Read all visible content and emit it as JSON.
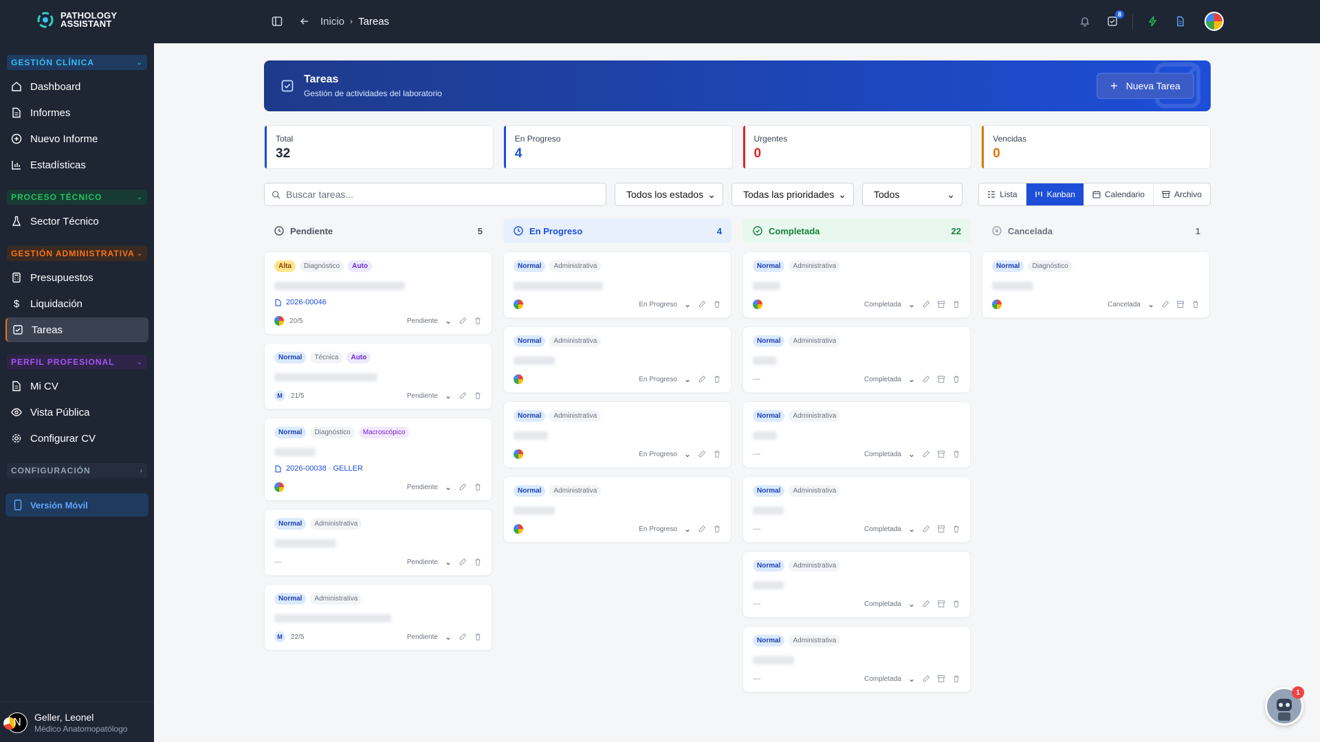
{
  "app": {
    "logo_line1": "PATHOLOGY",
    "logo_line2": "ASSISTANT"
  },
  "header": {
    "crumb_home": "Inicio",
    "crumb_current": "Tareas",
    "tasks_badge": "8"
  },
  "sidebar": {
    "sections": [
      {
        "label": "GESTIÓN CLÍNICA",
        "color": "#38bdf8",
        "items": [
          "Dashboard",
          "Informes",
          "Nuevo Informe",
          "Estadísticas"
        ]
      },
      {
        "label": "PROCESO TÉCNICO",
        "color": "#22c55e",
        "items": [
          "Sector Técnico"
        ]
      },
      {
        "label": "GESTIÓN ADMINISTRATIVA",
        "color": "#f97316",
        "items": [
          "Presupuestos",
          "Liquidación",
          "Tareas"
        ]
      },
      {
        "label": "PERFIL PROFESIONAL",
        "color": "#a855f7",
        "items": [
          "Mi CV",
          "Vista Pública",
          "Configurar CV"
        ]
      },
      {
        "label": "CONFIGURACIÓN",
        "color": "#94a3b8",
        "items": []
      }
    ],
    "mobile": "Versión Móvil",
    "user": {
      "initial": "N",
      "name": "Geller, Leonel",
      "role": "Médico Anatomopatólogo"
    }
  },
  "banner": {
    "title": "Tareas",
    "subtitle": "Gestión de actividades del laboratorio",
    "new_button": "Nueva Tarea"
  },
  "stats": [
    {
      "label": "Total",
      "value": "32",
      "color": "#1f2937"
    },
    {
      "label": "En Progreso",
      "value": "4",
      "color": "#1d4ed8"
    },
    {
      "label": "Urgentes",
      "value": "0",
      "color": "#dc2626"
    },
    {
      "label": "Vencidas",
      "value": "0",
      "color": "#d97706"
    }
  ],
  "filters": {
    "search_placeholder": "Buscar tareas...",
    "status": "Todos los estados",
    "priority": "Todas las prioridades",
    "assignee": "Todos",
    "views": [
      "Lista",
      "Kanban",
      "Calendario",
      "Archivo"
    ]
  },
  "columns": [
    {
      "title": "Pendiente",
      "count": "5",
      "color": "#4b5563",
      "bg": "#f5f6f8",
      "cards": [
        {
          "tags": [
            [
              "Alta",
              "alta"
            ],
            [
              "Diagnóstico",
              "cat"
            ],
            [
              "Auto",
              "auto"
            ]
          ],
          "case": "2026-00046",
          "avatar": "g",
          "date": "20/5",
          "status": "Pendiente"
        },
        {
          "tags": [
            [
              "Normal",
              "normal"
            ],
            [
              "Técnica",
              "cat"
            ],
            [
              "Auto",
              "auto"
            ]
          ],
          "case": "",
          "avatar": "m",
          "date": "21/5",
          "status": "Pendiente"
        },
        {
          "tags": [
            [
              "Normal",
              "normal"
            ],
            [
              "Diagnóstico",
              "cat"
            ],
            [
              "Macroscópico",
              "macro"
            ]
          ],
          "case": "2026-00038 · GELLER",
          "avatar": "g",
          "date": "",
          "status": "Pendiente"
        },
        {
          "tags": [
            [
              "Normal",
              "normal"
            ],
            [
              "Administrativa",
              "cat"
            ]
          ],
          "case": "",
          "avatar": "none",
          "date": "",
          "status": "Pendiente"
        },
        {
          "tags": [
            [
              "Normal",
              "normal"
            ],
            [
              "Administrativa",
              "cat"
            ]
          ],
          "case": "",
          "avatar": "m",
          "date": "22/5",
          "status": "Pendiente"
        }
      ]
    },
    {
      "title": "En Progreso",
      "count": "4",
      "color": "#1d4ed8",
      "bg": "#e8f0fe",
      "cards": [
        {
          "tags": [
            [
              "Normal",
              "normal"
            ],
            [
              "Administrativa",
              "cat"
            ]
          ],
          "case": "",
          "avatar": "g",
          "date": "",
          "status": "En Progreso"
        },
        {
          "tags": [
            [
              "Normal",
              "normal"
            ],
            [
              "Administrativa",
              "cat"
            ]
          ],
          "case": "",
          "avatar": "g",
          "date": "",
          "status": "En Progreso"
        },
        {
          "tags": [
            [
              "Normal",
              "normal"
            ],
            [
              "Administrativa",
              "cat"
            ]
          ],
          "case": "",
          "avatar": "g",
          "date": "",
          "status": "En Progreso"
        },
        {
          "tags": [
            [
              "Normal",
              "normal"
            ],
            [
              "Administrativa",
              "cat"
            ]
          ],
          "case": "",
          "avatar": "g",
          "date": "",
          "status": "En Progreso"
        }
      ]
    },
    {
      "title": "Completada",
      "count": "22",
      "color": "#15803d",
      "bg": "#e9f8ee",
      "cards": [
        {
          "tags": [
            [
              "Normal",
              "normal"
            ],
            [
              "Administrativa",
              "cat"
            ]
          ],
          "case": "",
          "avatar": "g",
          "date": "",
          "status": "Completada"
        },
        {
          "tags": [
            [
              "Normal",
              "normal"
            ],
            [
              "Administrativa",
              "cat"
            ]
          ],
          "case": "",
          "avatar": "none",
          "date": "",
          "status": "Completada"
        },
        {
          "tags": [
            [
              "Normal",
              "normal"
            ],
            [
              "Administrativa",
              "cat"
            ]
          ],
          "case": "",
          "avatar": "none",
          "date": "",
          "status": "Completada"
        },
        {
          "tags": [
            [
              "Normal",
              "normal"
            ],
            [
              "Administrativa",
              "cat"
            ]
          ],
          "case": "",
          "avatar": "none",
          "date": "",
          "status": "Completada"
        },
        {
          "tags": [
            [
              "Normal",
              "normal"
            ],
            [
              "Administrativa",
              "cat"
            ]
          ],
          "case": "",
          "avatar": "none",
          "date": "",
          "status": "Completada"
        },
        {
          "tags": [
            [
              "Normal",
              "normal"
            ],
            [
              "Administrativa",
              "cat"
            ]
          ],
          "case": "",
          "avatar": "none",
          "date": "",
          "status": "Completada"
        }
      ]
    },
    {
      "title": "Cancelada",
      "count": "1",
      "color": "#6b7280",
      "bg": "#f5f6f8",
      "cards": [
        {
          "tags": [
            [
              "Normal",
              "normal"
            ],
            [
              "Diagnóstico",
              "cat"
            ]
          ],
          "case": "",
          "avatar": "g",
          "date": "",
          "status": "Cancelada"
        }
      ]
    }
  ],
  "helper_badge": "1"
}
